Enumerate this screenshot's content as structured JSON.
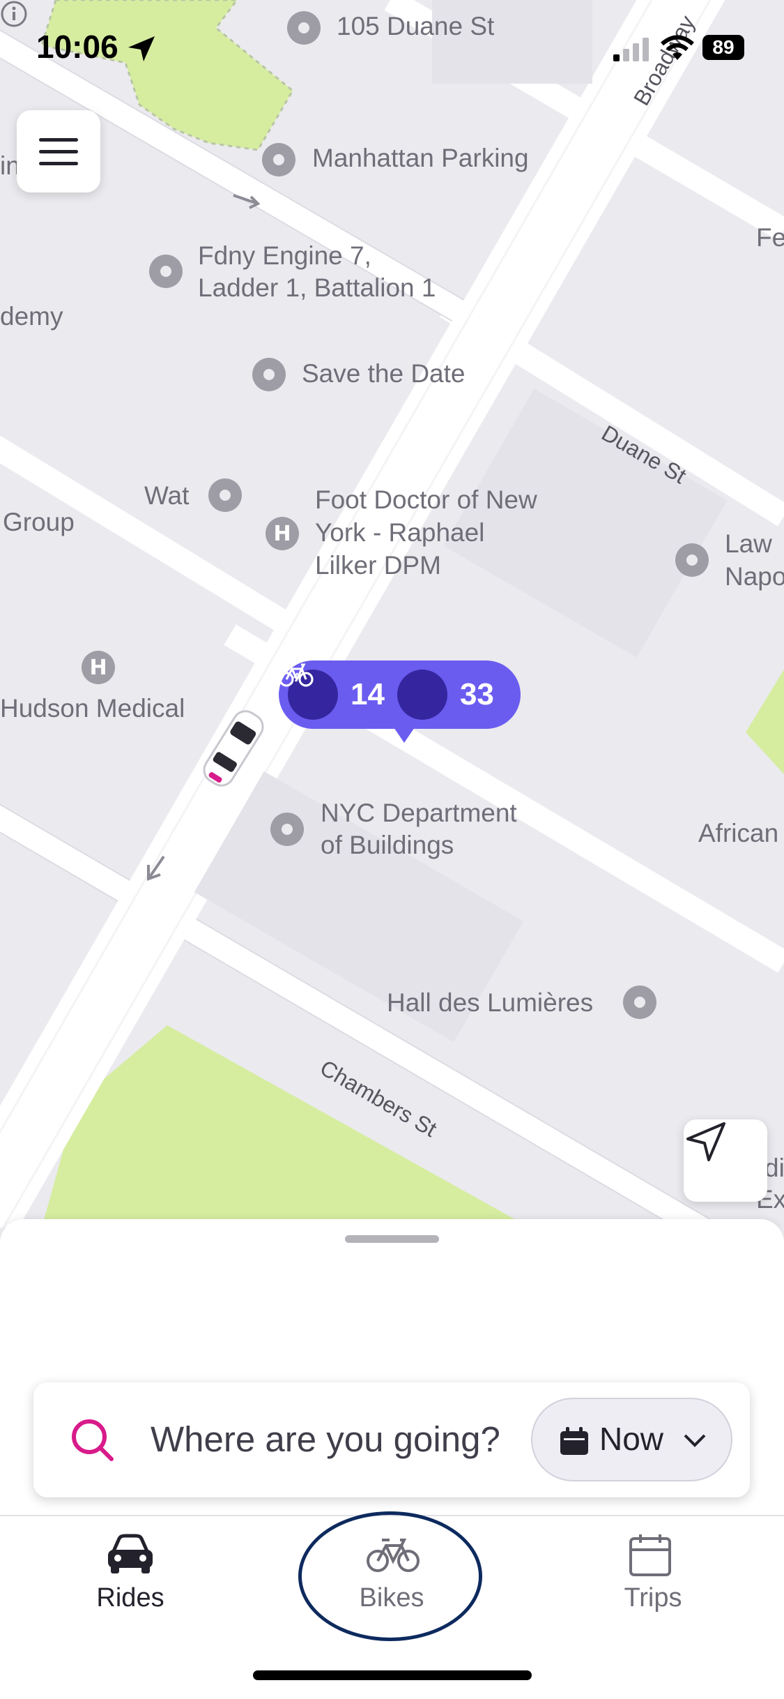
{
  "status_bar": {
    "time": "10:06",
    "battery": "89"
  },
  "map": {
    "pois": [
      {
        "name": "105 Duane St"
      },
      {
        "name": "Manhattan Parking"
      },
      {
        "name": "Fdny Engine 7,"
      },
      {
        "name": "Ladder 1, Battalion 1"
      },
      {
        "name": "Save the Date"
      },
      {
        "name": "Wat"
      },
      {
        "name": "Foot Doctor of New"
      },
      {
        "name": "York - Raphael"
      },
      {
        "name": "Lilker DPM"
      },
      {
        "name": "Hudson Medical"
      },
      {
        "name": "NYC Department"
      },
      {
        "name": "of Buildings"
      },
      {
        "name": "Hall des Lumières"
      },
      {
        "name": "Law"
      },
      {
        "name": "Napo"
      },
      {
        "name": "African"
      },
      {
        "name": "ing Club"
      },
      {
        "name": "demy"
      },
      {
        "name": "Group"
      },
      {
        "name": "Fe"
      },
      {
        "name": "di"
      },
      {
        "name": "Ex"
      }
    ],
    "streets": {
      "broadway": "Broadway",
      "duane": "Duane St",
      "chambers": "Chambers St"
    },
    "bike_station": {
      "ebikes": "14",
      "bikes": "33"
    }
  },
  "search": {
    "placeholder": "Where are you going?",
    "time_label": "Now"
  },
  "tabs": [
    {
      "label": "Rides",
      "icon": "car-icon",
      "active": true
    },
    {
      "label": "Bikes",
      "icon": "bike-icon",
      "active": false
    },
    {
      "label": "Trips",
      "icon": "calendar-icon",
      "active": false
    }
  ],
  "colors": {
    "accent": "#6b5cf0",
    "search_accent": "#d81b8a",
    "park": "#d6eda0"
  }
}
